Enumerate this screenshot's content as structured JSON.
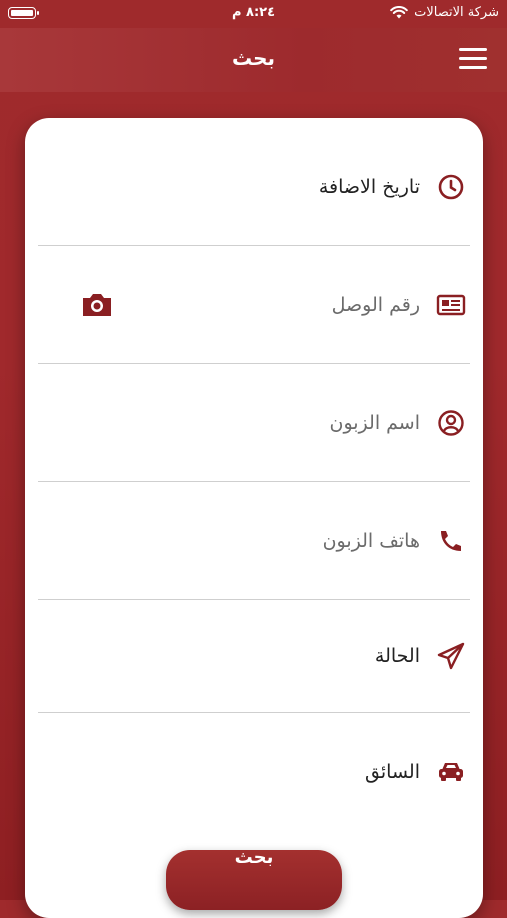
{
  "status_bar": {
    "carrier": "شركة الاتصالات",
    "time": "٨:٢٤ م"
  },
  "header": {
    "title": "بحث"
  },
  "form": {
    "fields": [
      {
        "label": "تاريخ الاضافة",
        "icon": "clock-icon",
        "placeholder": false
      },
      {
        "label": "رقم الوصل",
        "icon": "receipt-card-icon",
        "placeholder": true,
        "action_icon": "camera-icon"
      },
      {
        "label": "اسم الزبون",
        "icon": "user-circle-icon",
        "placeholder": true
      },
      {
        "label": "هاتف الزبون",
        "icon": "phone-icon",
        "placeholder": true
      },
      {
        "label": "الحالة",
        "icon": "paper-plane-icon",
        "placeholder": false
      },
      {
        "label": "السائق",
        "icon": "car-icon",
        "placeholder": false
      }
    ]
  },
  "actions": {
    "search_label": "بحث"
  },
  "colors": {
    "brand": "#9d2a2d",
    "icon": "#8a1f22"
  }
}
